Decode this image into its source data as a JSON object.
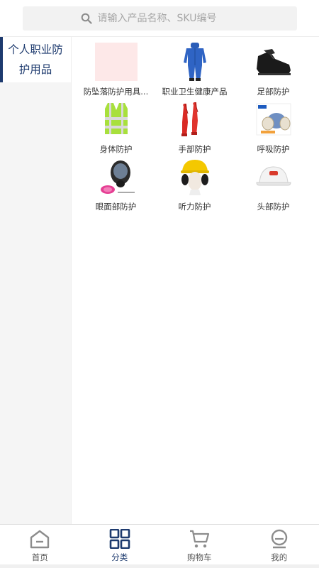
{
  "search": {
    "placeholder": "请输入产品名称、SKU编号"
  },
  "sidebar": {
    "items": [
      {
        "label": "个人职业防护用品",
        "active": true
      }
    ]
  },
  "categories": [
    {
      "label": "防坠落防护用具...",
      "icon": "image-placeholder-icon"
    },
    {
      "label": "职业卫生健康产品",
      "icon": "coverall-icon"
    },
    {
      "label": "足部防护",
      "icon": "safety-shoe-icon"
    },
    {
      "label": "身体防护",
      "icon": "reflective-vest-icon"
    },
    {
      "label": "手部防护",
      "icon": "glove-icon"
    },
    {
      "label": "呼吸防护",
      "icon": "respirator-icon"
    },
    {
      "label": "眼面部防护",
      "icon": "gas-mask-icon"
    },
    {
      "label": "听力防护",
      "icon": "earmuff-helmet-icon"
    },
    {
      "label": "头部防护",
      "icon": "hard-hat-icon"
    }
  ],
  "tabbar": {
    "tabs": [
      {
        "label": "首页",
        "icon": "home-icon",
        "active": false
      },
      {
        "label": "分类",
        "icon": "category-grid-icon",
        "active": true
      },
      {
        "label": "购物车",
        "icon": "cart-icon",
        "active": false
      },
      {
        "label": "我的",
        "icon": "profile-icon",
        "active": false
      }
    ]
  },
  "colors": {
    "accent": "#1d3a6e",
    "inactive": "#8c8c8c",
    "sidebar_bg": "#f5f5f5"
  }
}
